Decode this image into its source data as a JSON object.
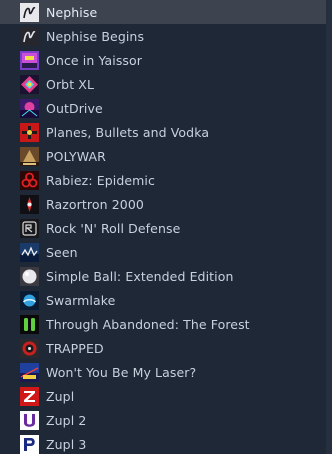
{
  "library": {
    "games": [
      {
        "name": "Nephise",
        "icon": "nephise-icon",
        "selected": true
      },
      {
        "name": "Nephise Begins",
        "icon": "nephise-begins-icon"
      },
      {
        "name": "Once in Yaissor",
        "icon": "once-in-yaissor-icon"
      },
      {
        "name": "Orbt XL",
        "icon": "orbt-xl-icon"
      },
      {
        "name": "OutDrive",
        "icon": "outdrive-icon"
      },
      {
        "name": "Planes, Bullets and Vodka",
        "icon": "planes-bullets-vodka-icon"
      },
      {
        "name": "POLYWAR",
        "icon": "polywar-icon"
      },
      {
        "name": "Rabiez: Epidemic",
        "icon": "biohazard-icon"
      },
      {
        "name": "Razortron 2000",
        "icon": "razortron-icon"
      },
      {
        "name": "Rock 'N' Roll Defense",
        "icon": "rock-n-roll-defense-icon"
      },
      {
        "name": "Seen",
        "icon": "seen-icon"
      },
      {
        "name": "Simple Ball: Extended Edition",
        "icon": "simple-ball-icon"
      },
      {
        "name": "Swarmlake",
        "icon": "swarmlake-icon"
      },
      {
        "name": "Through Abandoned: The Forest",
        "icon": "through-abandoned-icon"
      },
      {
        "name": "TRAPPED",
        "icon": "trapped-icon"
      },
      {
        "name": "Won't You Be My Laser?",
        "icon": "laser-icon"
      },
      {
        "name": "Zupl",
        "icon": "zupl-icon"
      },
      {
        "name": "Zupl 2",
        "icon": "zupl-2-icon"
      },
      {
        "name": "Zupl 3",
        "icon": "zupl-3-icon"
      }
    ]
  },
  "colors": {
    "background": "#1e2837",
    "selected_row": "#3d4450",
    "text": "#c7d2dd"
  }
}
